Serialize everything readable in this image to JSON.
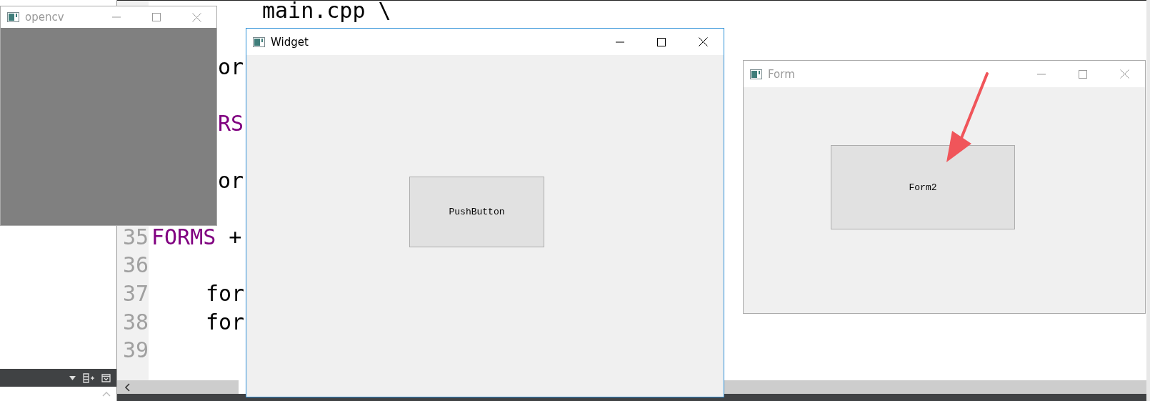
{
  "editor": {
    "lines": [
      {
        "tokens": [
          {
            "text": "main.cpp \\",
            "kind": "plain"
          }
        ]
      },
      {
        "tokens": [
          {
            "text": "or",
            "kind": "plain"
          }
        ]
      },
      {
        "tokens": [
          {
            "text": "RS",
            "kind": "keyword"
          }
        ]
      },
      {
        "tokens": [
          {
            "text": "or",
            "kind": "plain"
          }
        ]
      },
      {
        "number": "35",
        "tokens": [
          {
            "text": "FORMS",
            "kind": "keyword"
          },
          {
            "text": "+",
            "kind": "plain"
          }
        ]
      },
      {
        "number": "36"
      },
      {
        "number": "37",
        "tokens": [
          {
            "text": "for",
            "kind": "plain"
          }
        ]
      },
      {
        "number": "38",
        "tokens": [
          {
            "text": "for",
            "kind": "plain"
          }
        ]
      },
      {
        "number": "39"
      }
    ]
  },
  "windows": [
    {
      "title": "opencv",
      "active": false,
      "kind": "canvas"
    },
    {
      "title": "Widget",
      "active": true,
      "kind": "form",
      "button": "PushButton"
    },
    {
      "title": "Form",
      "active": false,
      "kind": "form",
      "button": "Form2"
    }
  ]
}
